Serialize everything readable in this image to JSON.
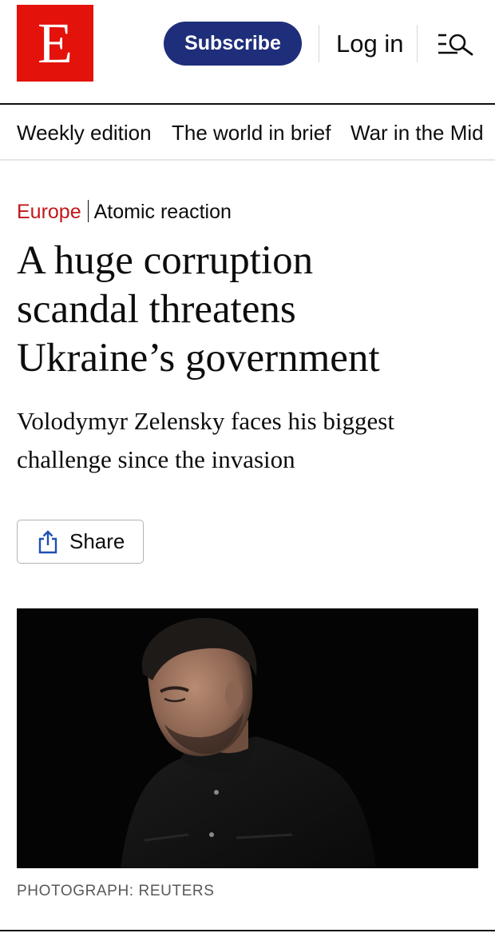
{
  "header": {
    "logo_text": "E",
    "subscribe_label": "Subscribe",
    "login_label": "Log in",
    "menu_icon": "menu-search-icon",
    "brand_red": "#e3120b",
    "subscribe_blue": "#1f2e7a"
  },
  "nav": {
    "items": [
      {
        "label": "Weekly edition"
      },
      {
        "label": "The world in brief"
      },
      {
        "label": "War in the Mid"
      }
    ]
  },
  "article": {
    "section": "Europe",
    "rubric": "Atomic reaction",
    "headline_lines": [
      "A huge corruption",
      "scandal threatens",
      "Ukraine’s government"
    ],
    "subhead_lines": [
      "Volodymyr Zelensky faces his biggest",
      "challenge since the invasion"
    ],
    "share_label": "Share",
    "share_icon": "share-icon",
    "photo_caption": "PHOTOGRAPH: REUTERS",
    "section_color": "#c3171b"
  }
}
